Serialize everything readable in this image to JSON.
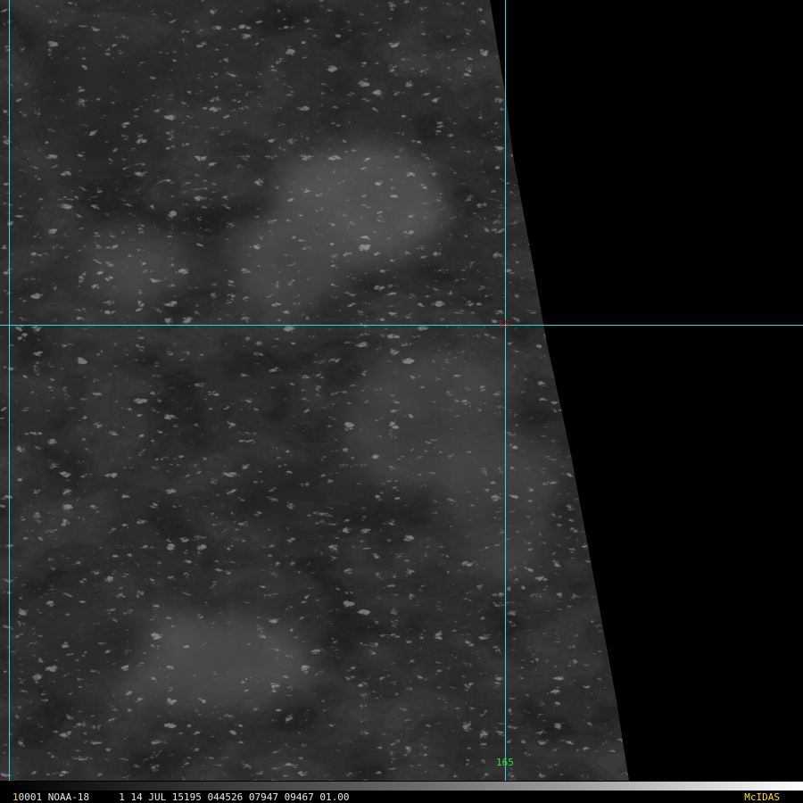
{
  "image": {
    "background_color": "#000000",
    "cloud_base_color": "#3a3a3a",
    "gridline_color": "#33d6e0",
    "latitude_label": {
      "text": "15",
      "color": "#b01818"
    },
    "longitude_label": {
      "text": "165",
      "color": "#33dd33"
    }
  },
  "status_bar": {
    "frame_number": "1",
    "frame_number_color": "#ffe000",
    "info_text": "0001 NOAA-18     1 14 JUL 15195 044526 07947 09467 01.00",
    "brand": "McIDAS",
    "brand_color": "#ffe000"
  }
}
